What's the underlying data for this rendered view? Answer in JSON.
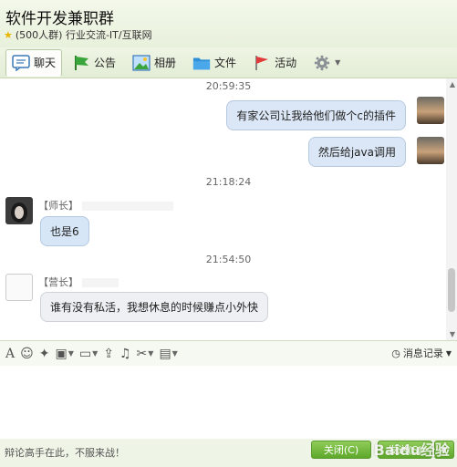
{
  "header": {
    "title": "软件开发兼职群",
    "meta": "(500人群) 行业交流-IT/互联网"
  },
  "tabs": [
    {
      "label": "聊天",
      "icon": "chat-icon"
    },
    {
      "label": "公告",
      "icon": "flag-icon"
    },
    {
      "label": "相册",
      "icon": "photo-icon"
    },
    {
      "label": "文件",
      "icon": "folder-icon"
    },
    {
      "label": "活动",
      "icon": "activity-flag-icon"
    }
  ],
  "messages": {
    "ts1": "20:59:35",
    "m1": "有家公司让我给他们做个c的插件",
    "m2": "然后给java调用",
    "ts2": "21:18:24",
    "sender1": "【师长】",
    "m3": "也是6",
    "ts3": "21:54:50",
    "sender2": "【营长】",
    "m4": "谁有没有私活，我想休息的时候赚点小外快"
  },
  "toolbar": {
    "history_label": "消息记录"
  },
  "footer": {
    "slogan": "辩论高手在此，不服来战！",
    "close_label": "关闭(C)",
    "send_label": "发送(S)",
    "watermark": "Baidu经验"
  },
  "colors": {
    "accent_green": "#5ea82b",
    "bubble_blue": "#dbe7f6"
  }
}
